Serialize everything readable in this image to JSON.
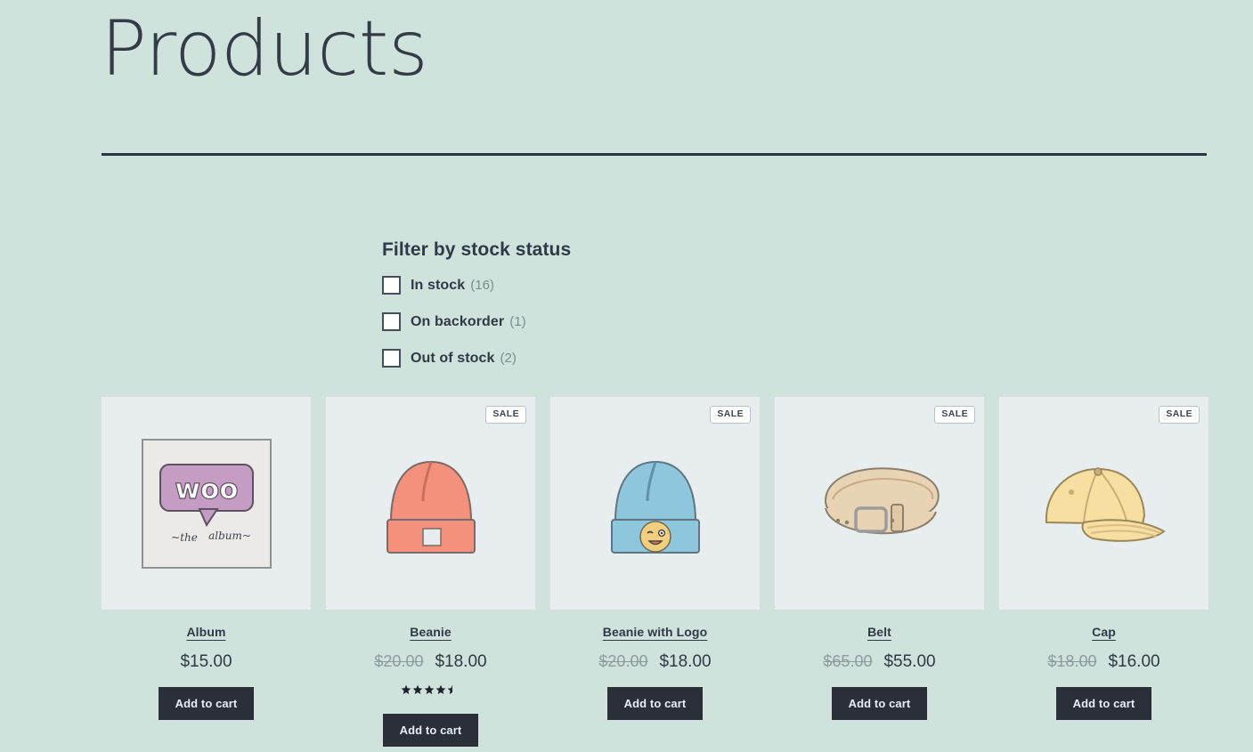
{
  "header": {
    "title": "Products"
  },
  "filter": {
    "heading": "Filter by stock status",
    "options": [
      {
        "label": "In stock",
        "count": "(16)",
        "checked": false
      },
      {
        "label": "On backorder",
        "count": "(1)",
        "checked": false
      },
      {
        "label": "Out of stock",
        "count": "(2)",
        "checked": false
      }
    ]
  },
  "colors": {
    "page_background": "#cfe2db",
    "thumb_background": "#e8edef",
    "text_dark": "#2f3a46",
    "button_background": "#2b3038",
    "button_text": "#e7eef3",
    "muted_text": "#8d9ba1",
    "rule": "#2b3442"
  },
  "products": [
    {
      "name": "Album",
      "icon": "woo-album-artwork",
      "on_sale": false,
      "sale_label": "",
      "price_old": "",
      "price_now": "$15.00",
      "rating": null,
      "add_to_cart_label": "Add to cart"
    },
    {
      "name": "Beanie",
      "icon": "orange-beanie-hat",
      "on_sale": true,
      "sale_label": "SALE",
      "price_old": "$20.00",
      "price_now": "$18.00",
      "rating": 4.5,
      "add_to_cart_label": "Add to cart"
    },
    {
      "name": "Beanie with Logo",
      "icon": "blue-beanie-hat-with-emoji-patch",
      "on_sale": true,
      "sale_label": "SALE",
      "price_old": "$20.00",
      "price_now": "$18.00",
      "rating": null,
      "add_to_cart_label": "Add to cart"
    },
    {
      "name": "Belt",
      "icon": "tan-leather-belt",
      "on_sale": true,
      "sale_label": "SALE",
      "price_old": "$65.00",
      "price_now": "$55.00",
      "rating": null,
      "add_to_cart_label": "Add to cart"
    },
    {
      "name": "Cap",
      "icon": "yellow-baseball-cap",
      "on_sale": true,
      "sale_label": "SALE",
      "price_old": "$18.00",
      "price_now": "$16.00",
      "rating": null,
      "add_to_cart_label": "Add to cart"
    }
  ]
}
